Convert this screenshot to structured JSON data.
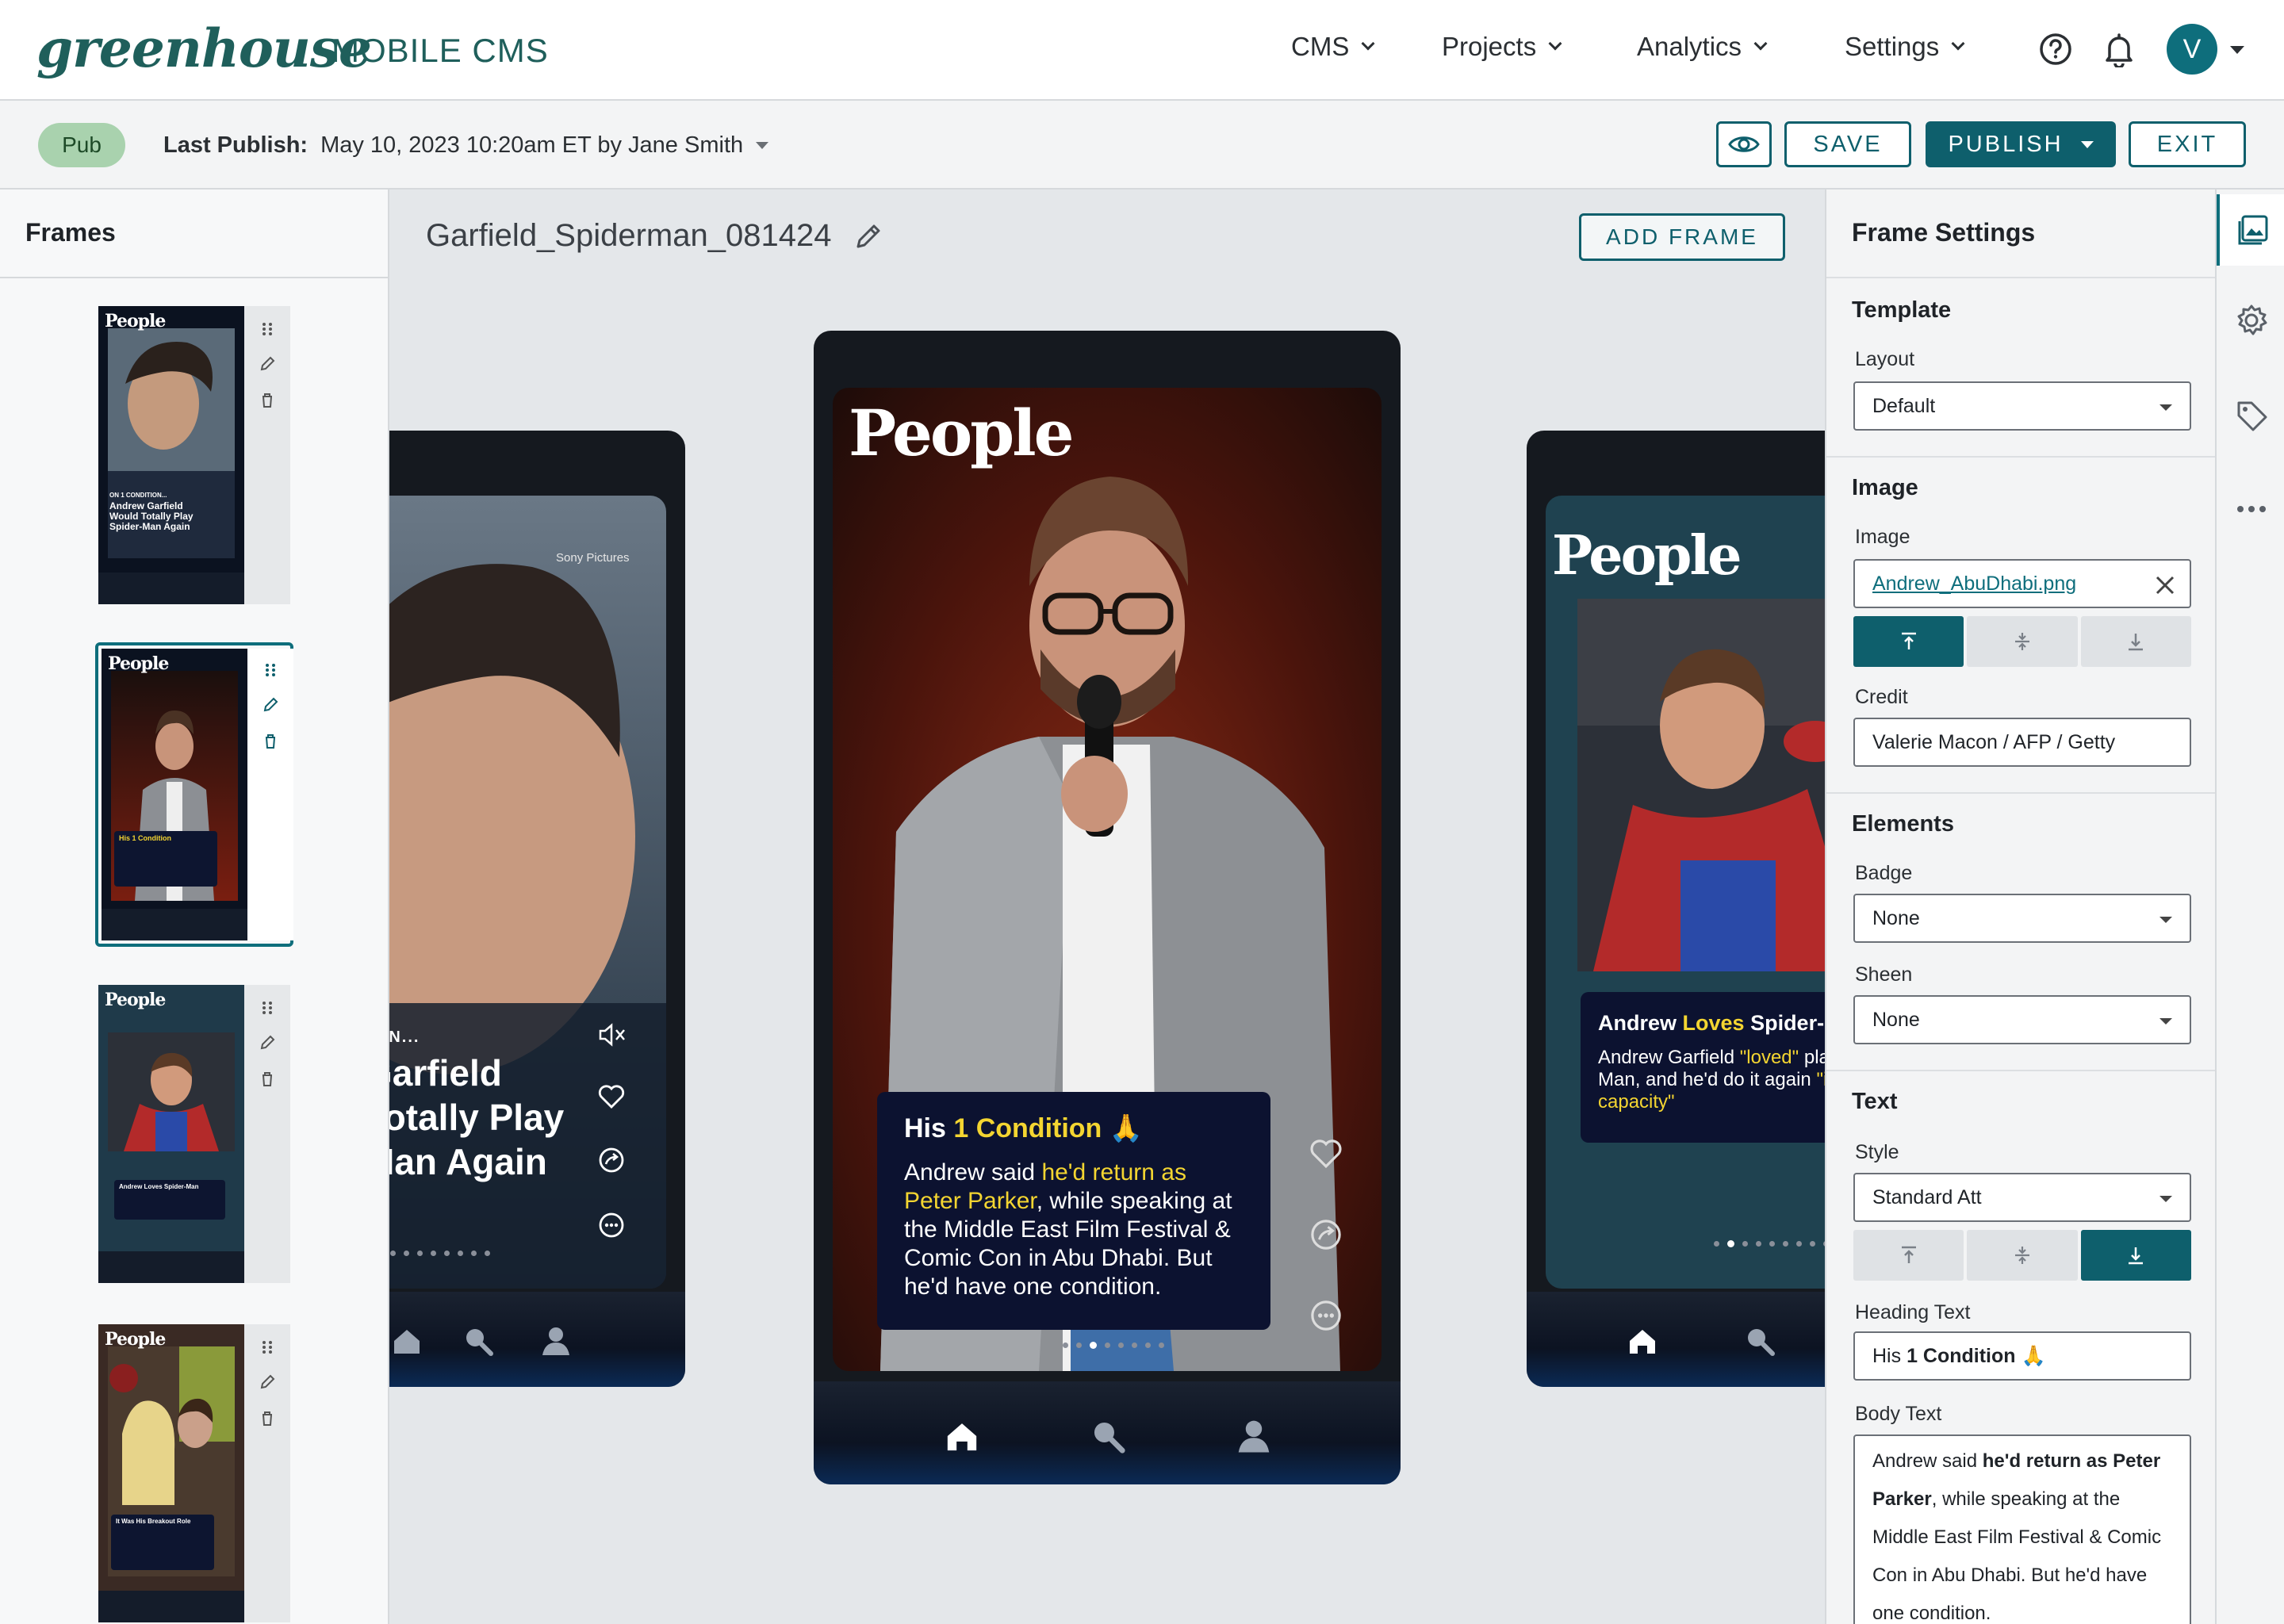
{
  "brand": {
    "logo": "greenhouse",
    "product": "MOBILE CMS"
  },
  "nav": {
    "items": [
      {
        "label": "CMS"
      },
      {
        "label": "Projects"
      },
      {
        "label": "Analytics"
      },
      {
        "label": "Settings"
      }
    ],
    "help_icon": "help-circle-icon",
    "notifications_icon": "bell-icon",
    "user_initial": "V"
  },
  "toolbar": {
    "status_badge": "Pub",
    "last_publish_label": "Last Publish:",
    "last_publish_value": "May 10, 2023 10:20am ET by Jane Smith",
    "preview_icon": "eye-icon",
    "save_label": "SAVE",
    "publish_label": "PUBLISH",
    "exit_label": "EXIT"
  },
  "frames_panel": {
    "title": "Frames",
    "frames": [
      {
        "logo": "People",
        "headline": "Andrew Garfield Would Totally Play Spider-Man Again",
        "kicker": "ON 1 CONDITION..."
      },
      {
        "logo": "People",
        "headline": "His 1 Condition",
        "active": true
      },
      {
        "logo": "People",
        "headline": "Andrew Loves Spider-Man"
      },
      {
        "logo": "People",
        "headline": "It Was His Breakout Role"
      }
    ]
  },
  "canvas": {
    "frame_name": "Garfield_Spiderman_081424",
    "add_frame_label": "ADD FRAME",
    "left_preview": {
      "credit": "Sony Pictures",
      "kicker": "TION...",
      "headline_lines": [
        "Garfield",
        "Totally Play",
        "Man Again"
      ]
    },
    "center_preview": {
      "logo": "People",
      "heading_pre": "His ",
      "heading_hl": "1 Condition",
      "heading_post": " 🙏",
      "body_1": "Andrew said ",
      "body_hl1": "he'd return as Peter Parker",
      "body_2": ", while speaking at the Middle East Film Festival & Comic Con in Abu Dhabi. But he'd have one condition."
    },
    "right_preview": {
      "logo": "People",
      "heading_pre": "Andrew ",
      "heading_hl": "Loves",
      "heading_post": " Spider-Man",
      "body_1": "Andrew Garfield ",
      "body_hl1": "\"loved\"",
      "body_2": " playing Spider-Man, and he'd do it again ",
      "body_hl2": "\"in some capacity\""
    }
  },
  "settings": {
    "title": "Frame Settings",
    "template": {
      "title": "Template",
      "layout_label": "Layout",
      "layout_value": "Default"
    },
    "image": {
      "title": "Image",
      "image_label": "Image",
      "image_value": "Andrew_AbuDhabi.png",
      "credit_label": "Credit",
      "credit_value": "Valerie Macon / AFP / Getty",
      "align_selected": "top"
    },
    "elements": {
      "title": "Elements",
      "badge_label": "Badge",
      "badge_value": "None",
      "sheen_label": "Sheen",
      "sheen_value": "None"
    },
    "text": {
      "title": "Text",
      "style_label": "Style",
      "style_value": "Standard Att",
      "align_selected": "bottom",
      "heading_label": "Heading Text",
      "heading_pre": "His ",
      "heading_bold": "1 Condition",
      "heading_post": " 🙏",
      "body_label": "Body Text",
      "body_1": "Andrew said ",
      "body_bold": "he'd return as Peter Parker",
      "body_2": ", while speaking at the Middle East Film Festival & Comic Con in Abu Dhabi. But he'd have one condition."
    }
  },
  "rail": {
    "items": [
      "image-settings-icon",
      "gear-icon",
      "tag-icon",
      "more-icon"
    ]
  },
  "colors": {
    "brand": "#1f5f5b",
    "accent": "#0e5f6c",
    "highlight": "#f4d531",
    "pub_badge": "#a9d2ae"
  }
}
